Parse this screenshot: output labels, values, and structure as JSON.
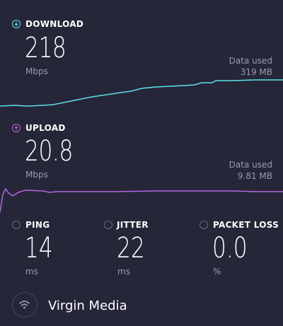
{
  "download": {
    "label": "DOWNLOAD",
    "value": "218",
    "unit": "Mbps",
    "data_used_label": "Data used",
    "data_used_value": "319 MB",
    "color": "#5ce1e6"
  },
  "upload": {
    "label": "UPLOAD",
    "value": "20.8",
    "unit": "Mbps",
    "data_used_label": "Data used",
    "data_used_value": "9.81 MB",
    "color": "#b566e0"
  },
  "stats": {
    "ping": {
      "label": "PING",
      "value": "14",
      "unit": "ms"
    },
    "jitter": {
      "label": "JITTER",
      "value": "22",
      "unit": "ms"
    },
    "packet_loss": {
      "label": "PACKET LOSS",
      "value": "0.0",
      "unit": "%"
    }
  },
  "provider": {
    "name": "Virgin Media",
    "icon": "wifi-icon"
  }
}
